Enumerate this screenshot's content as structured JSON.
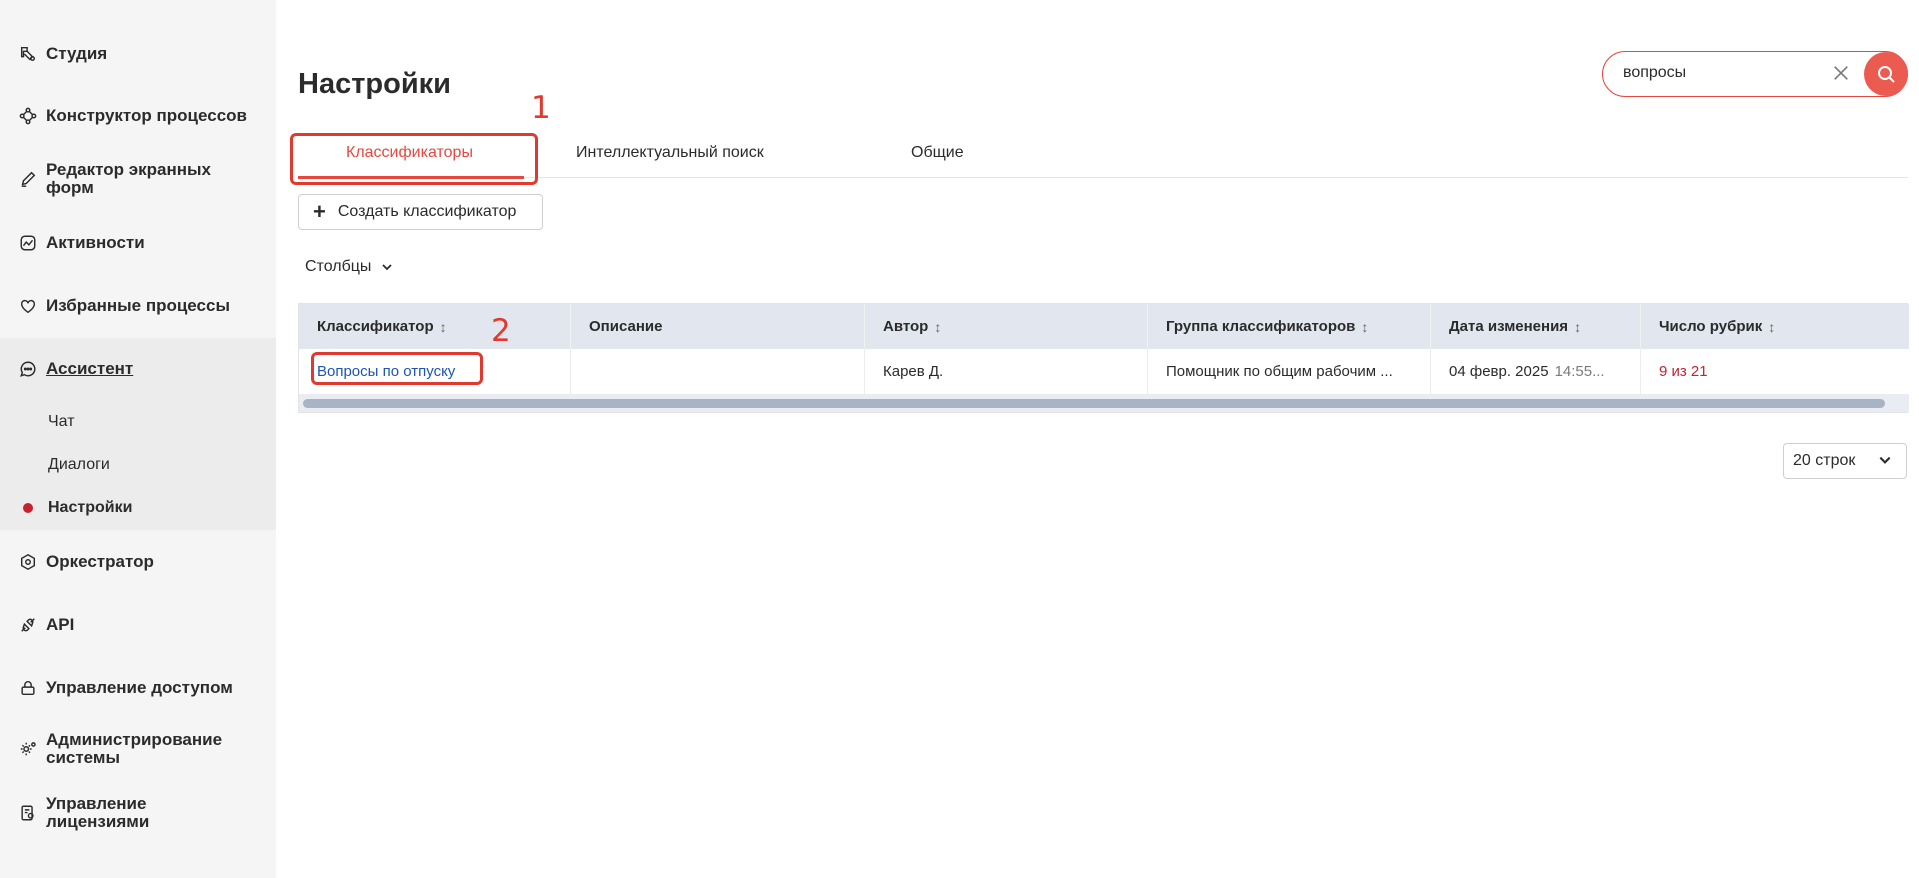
{
  "sidebar": {
    "items": [
      {
        "label": "Студия",
        "icon": "studio-icon"
      },
      {
        "label": "Конструктор процессов",
        "icon": "process-constructor-icon"
      },
      {
        "label": "Редактор экранных\nформ",
        "icon": "form-editor-icon"
      },
      {
        "label": "Активности",
        "icon": "activity-icon"
      },
      {
        "label": "Избранные процессы",
        "icon": "heart-icon"
      },
      {
        "label": "Ассистент",
        "icon": "assistant-icon"
      },
      {
        "label": "Оркестратор",
        "icon": "orchestrator-icon"
      },
      {
        "label": "API",
        "icon": "api-icon"
      },
      {
        "label": "Управление доступом",
        "icon": "lock-icon"
      },
      {
        "label": "Администрирование\nсистемы",
        "icon": "admin-gear-icon"
      },
      {
        "label": "Управление\nлицензиями",
        "icon": "license-icon"
      }
    ],
    "assistant_sub": [
      {
        "label": "Чат"
      },
      {
        "label": "Диалоги"
      },
      {
        "label": "Настройки"
      }
    ]
  },
  "page": {
    "title": "Настройки"
  },
  "search": {
    "value": "вопросы",
    "accent": "#ec5b50"
  },
  "tabs": [
    {
      "label": "Классификаторы",
      "active": true
    },
    {
      "label": "Интеллектуальный поиск",
      "active": false
    },
    {
      "label": "Общие",
      "active": false
    }
  ],
  "toolbar": {
    "create_label": "Создать классификатор",
    "columns_label": "Столбцы"
  },
  "table": {
    "columns": [
      "Классификатор",
      "Описание",
      "Автор",
      "Группа классификаторов",
      "Дата изменения",
      "Число рубрик"
    ],
    "rows": [
      {
        "classifier": "Вопросы по отпуску",
        "description": "",
        "author": "Карев Д.",
        "group": "Помощник по общим рабочим ...",
        "date": "04 февр. 2025",
        "time": "14:55...",
        "rubrics": "9 из 21"
      }
    ]
  },
  "pagination": {
    "rows_label": "20 строк"
  },
  "annotations": [
    "1",
    "2"
  ]
}
